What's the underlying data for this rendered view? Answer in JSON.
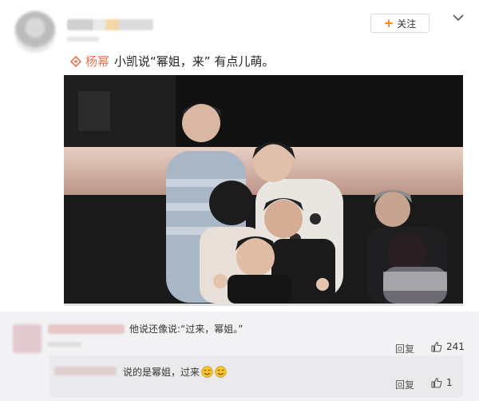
{
  "post": {
    "follow_label": "关注",
    "mention": "杨幂",
    "text": "小凯说“幂姐，来” 有点儿萌。"
  },
  "comments": [
    {
      "text": "他说还像说:“过来，幂姐。”",
      "reply_label": "回复",
      "likes": "241",
      "replies": [
        {
          "text": "说的是幂姐，过来",
          "reply_label": "回复",
          "likes": "1"
        }
      ]
    }
  ],
  "colors": {
    "mention": "#eb7350",
    "follow_plus": "#ff8200",
    "comment_bg": "#f2f2f5"
  }
}
